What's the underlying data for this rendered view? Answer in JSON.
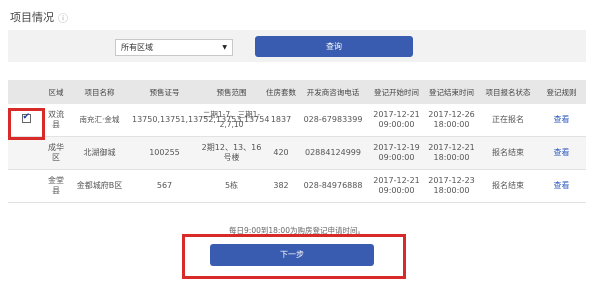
{
  "page": {
    "title": "项目情况",
    "title_icon": "info-circle-icon"
  },
  "filter": {
    "district_value": "所有区域",
    "query_label": "查询"
  },
  "table": {
    "headers": [
      "",
      "区域",
      "项目名称",
      "预售证号",
      "预售范围",
      "住房套数",
      "开发商咨询电话",
      "登记开始时间",
      "登记结束时间",
      "项目报名状态",
      "登记规则"
    ],
    "rows": [
      {
        "checked": true,
        "district": "双流县",
        "project": "南充汇·金城",
        "permit": "13750,13751,13752,13753,13754",
        "range": "二期1-7、三期1-2,7,10",
        "units": "1837",
        "phone": "028-67983399",
        "start_date": "2017-12-21",
        "start_time": "09:00:00",
        "end_date": "2017-12-26",
        "end_time": "18:00:00",
        "status": "正在报名",
        "rule": "查看"
      },
      {
        "checked": false,
        "district": "成华区",
        "project": "北湖御城",
        "permit": "100255",
        "range": "2期12、13、16号楼",
        "units": "420",
        "phone": "02884124999",
        "start_date": "2017-12-19",
        "start_time": "09:00:00",
        "end_date": "2017-12-21",
        "end_time": "18:00:00",
        "status": "报名结束",
        "rule": "查看"
      },
      {
        "checked": false,
        "district": "金堂县",
        "project": "金都城府B区",
        "permit": "567",
        "range": "5栋",
        "units": "382",
        "phone": "028-84976888",
        "start_date": "2017-12-21",
        "start_time": "09:00:00",
        "end_date": "2017-12-23",
        "end_time": "18:00:00",
        "status": "报名结束",
        "rule": "查看"
      }
    ]
  },
  "note": "每日9:00到18:00为购房登记申请时间。",
  "next_label": "下一步",
  "colors": {
    "accent": "#3a5cb0",
    "highlight": "#d92a2a",
    "link": "#2f5bbf"
  }
}
